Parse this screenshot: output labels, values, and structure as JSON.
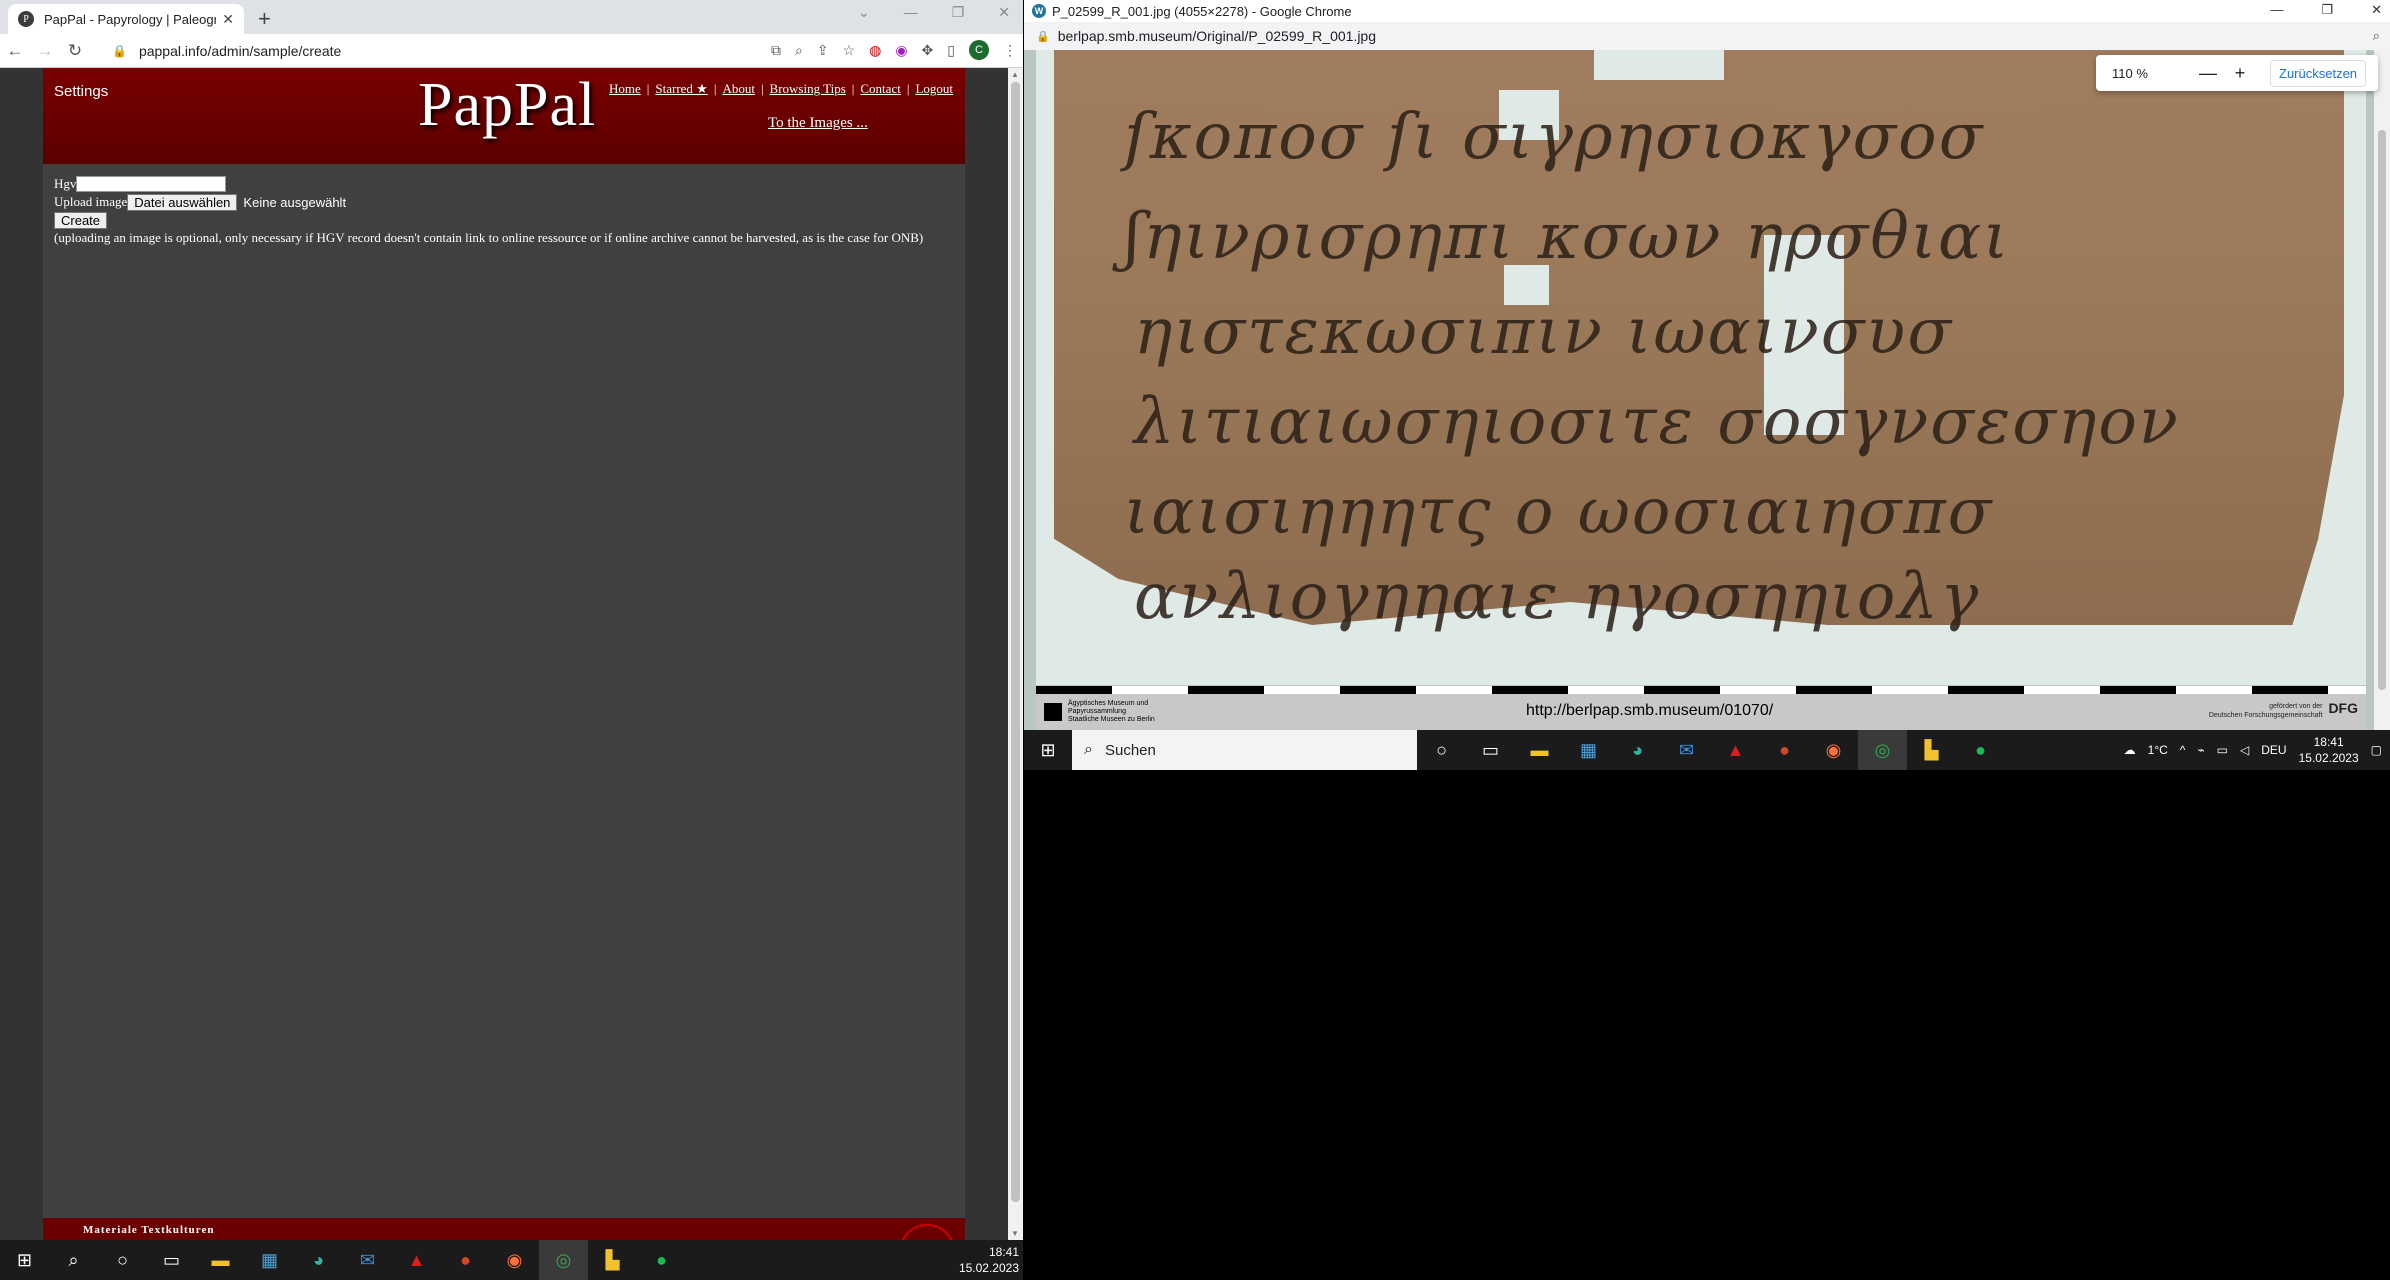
{
  "left_window": {
    "tab_title": "PapPal - Papyrology | Paleograph",
    "tab_favicon": "P",
    "url": "pappal.info/admin/sample/create",
    "profile_initial": "C",
    "page": {
      "settings": "Settings",
      "logo": "PapPal",
      "nav": [
        "Home",
        "Starred ★",
        "About",
        "Browsing Tips",
        "Contact",
        "Logout"
      ],
      "to_images": "To the Images ...",
      "hgv_label": "Hgv",
      "upload_label": "Upload image",
      "file_button": "Datei auswählen",
      "no_file": "Keine ausgewählt",
      "create_button": "Create",
      "note": "(uploading an image is optional, only necessary if HGV record doesn't contain link to online ressource or if online archive cannot be harvested, as is the case for ONB)",
      "footer_text": "Materiale Textkulturen"
    },
    "taskbar_clock": {
      "time": "18:41",
      "date": "15.02.2023"
    }
  },
  "right_window": {
    "title": "P_02599_R_001.jpg (4055×2278) - Google Chrome",
    "url": "berlpap.smb.museum/Original/P_02599_R_001.jpg",
    "zoom": {
      "level": "110 %",
      "minus": "—",
      "plus": "+",
      "reset": "Zurücksetzen"
    },
    "caption_url": "http://berlpap.smb.museum/01070/",
    "museum_text": [
      "Ägyptisches Museum und",
      "Papyrussammlung",
      "Staatliche Museen zu Berlin"
    ],
    "dfg_text": [
      "gefördert von der",
      "Deutschen Forschungsgemeinschaft"
    ],
    "dfg_logo": "DFG",
    "taskbar": {
      "search": "Suchen",
      "weather": "1°C",
      "lang": "DEU",
      "time": "18:41",
      "date": "15.02.2023"
    }
  },
  "colors": {
    "header_red": "#6a0000",
    "page_grey": "#404040",
    "papyrus": "#9b7a5a"
  }
}
